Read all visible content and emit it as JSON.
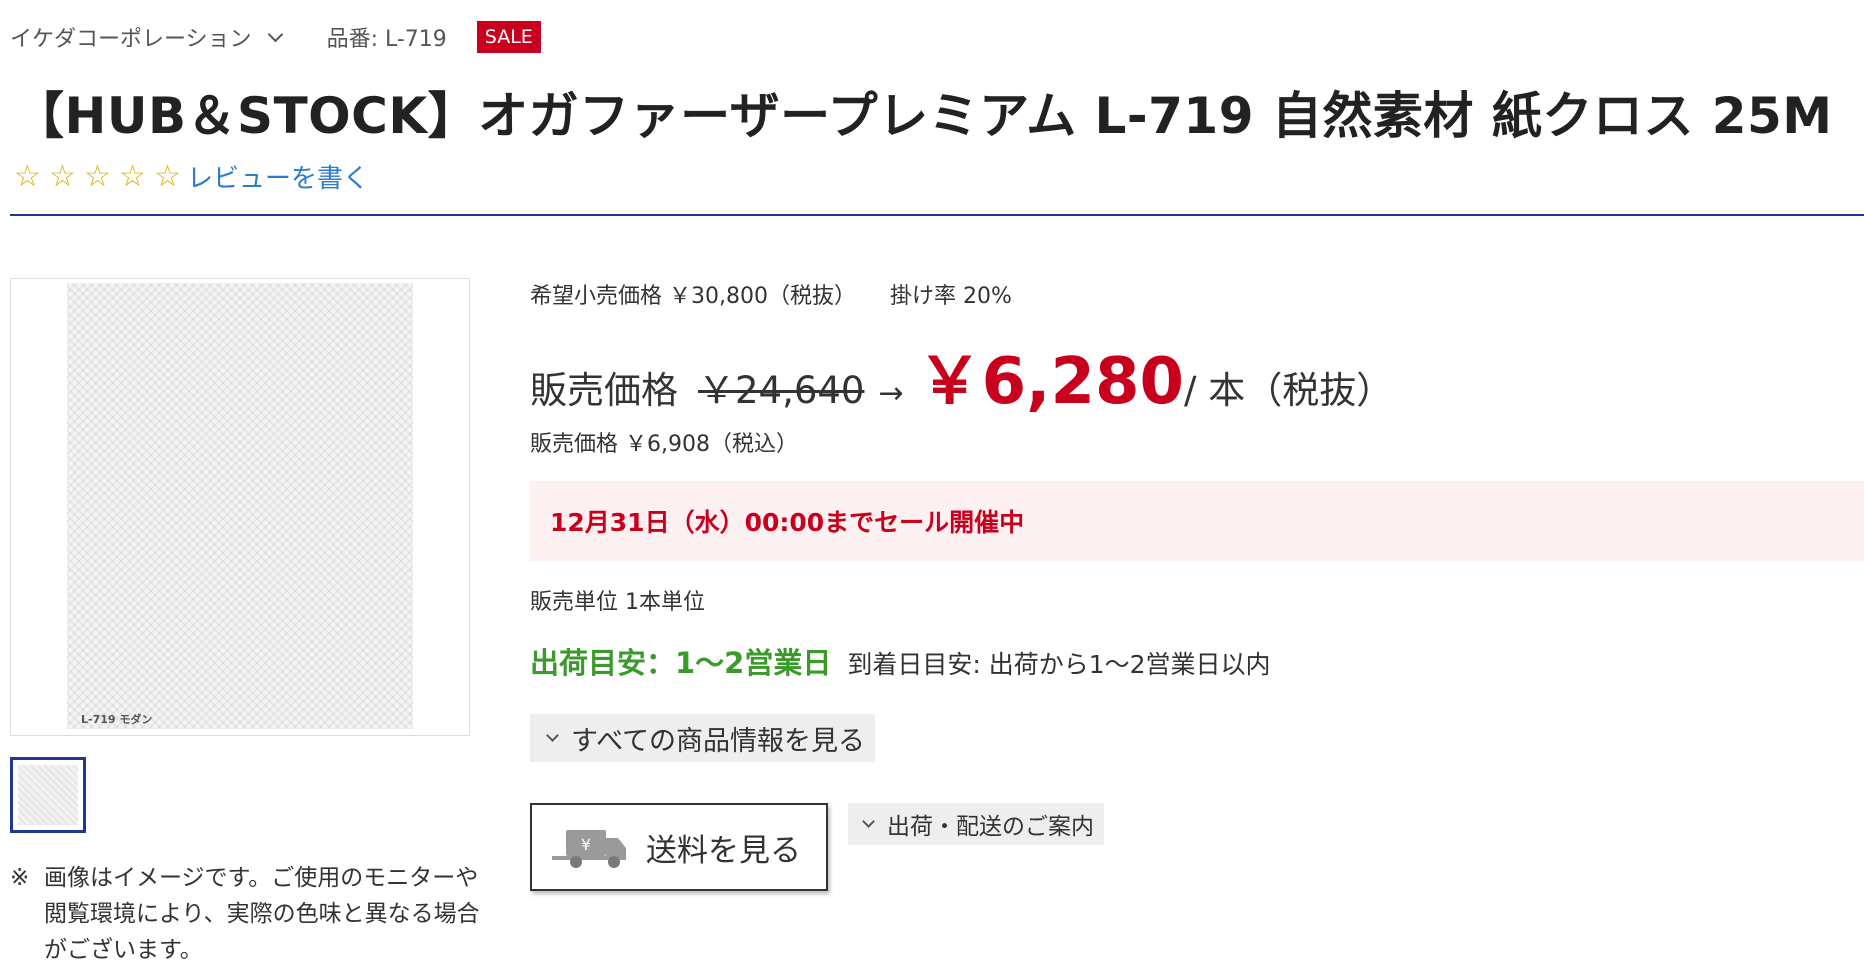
{
  "header": {
    "maker": "イケダコーポレーション",
    "part_number": "品番: L-719",
    "sale_badge": "SALE"
  },
  "product": {
    "title": "【HUB＆STOCK】オガファーザープレミアム L-719 自然素材 紙クロス 25M",
    "rating_stars": 5,
    "rating_value": 0,
    "review_link": "レビューを書く",
    "image_label": "L-719 モダン",
    "disclaimer_mark": "※",
    "disclaimer": "画像はイメージです。ご使用のモニターや閲覧環境により、実際の色味と異なる場合がございます。"
  },
  "pricing": {
    "retail_price": "希望小売価格 ￥30,800（税抜）",
    "rate": "掛け率 20%",
    "price_label": "販売価格",
    "old_price": "￥24,640",
    "arrow": "→",
    "new_price": "￥6,280",
    "unit": "/ 本（税抜）",
    "tax_included": "販売価格 ￥6,908（税込）"
  },
  "sale_banner": "12月31日（水）00:00までセール開催中",
  "sell_unit": "販売単位 1本単位",
  "shipping": {
    "eta": "出荷目安：1～2営業日",
    "arrival": "到着日目安: 出荷から1～2営業日以内"
  },
  "buttons": {
    "more_info": "すべての商品情報を見る",
    "shipping_fee": "送料を見る",
    "shipping_guide": "出荷・配送のご案内"
  },
  "colors": {
    "accent_red": "#c8001e",
    "link_blue": "#2a7ccf",
    "eta_green": "#3a9a2a",
    "divider_navy": "#1f3a8a"
  },
  "icons": {
    "star": "star-outline-icon",
    "chevron": "chevron-down-icon",
    "truck": "truck-yen-icon"
  }
}
